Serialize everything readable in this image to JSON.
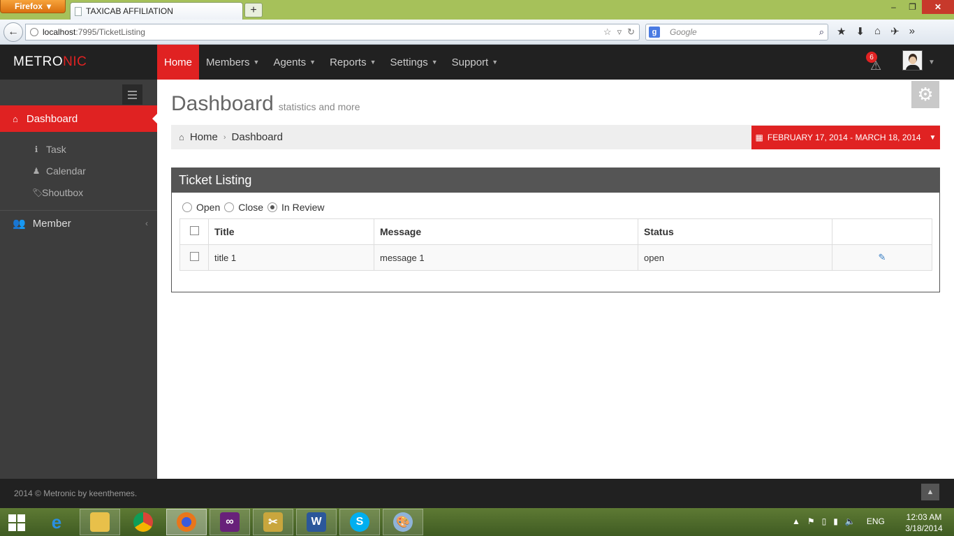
{
  "browser": {
    "menu_button": "Firefox",
    "tab_title": "TAXICAB AFFILIATION",
    "url_host": "localhost",
    "url_path": ":7995/TicketListing",
    "search_placeholder": "Google"
  },
  "app": {
    "logo_a": "METRO",
    "logo_b": "NIC",
    "topnav": [
      {
        "label": "Home"
      },
      {
        "label": "Members"
      },
      {
        "label": "Agents"
      },
      {
        "label": "Reports"
      },
      {
        "label": "Settings"
      },
      {
        "label": "Support"
      }
    ],
    "notification_count": "6"
  },
  "sidebar": {
    "active": "Dashboard",
    "sub_items": [
      "Task",
      "Calendar",
      "Shoutbox"
    ],
    "member": "Member"
  },
  "page": {
    "title": "Dashboard",
    "subtitle": "statistics and more",
    "breadcrumb": [
      "Home",
      "Dashboard"
    ],
    "date_range": "FEBRUARY 17, 2014 - MARCH 18, 2014"
  },
  "portlet": {
    "title": "Ticket Listing",
    "filters": [
      {
        "label": "Open",
        "checked": false
      },
      {
        "label": "Close",
        "checked": false
      },
      {
        "label": "In Review",
        "checked": true
      }
    ],
    "columns": [
      "Title",
      "Message",
      "Status"
    ],
    "rows": [
      {
        "title": "title 1",
        "message": "message 1",
        "status": "open"
      }
    ]
  },
  "footer": {
    "text": "2014 © Metronic by keenthemes."
  },
  "taskbar": {
    "language": "ENG",
    "time": "12:03 AM",
    "date": "3/18/2014"
  },
  "colors": {
    "accent": "#e02222",
    "header": "#212121",
    "sidebar": "#3d3d3d"
  }
}
